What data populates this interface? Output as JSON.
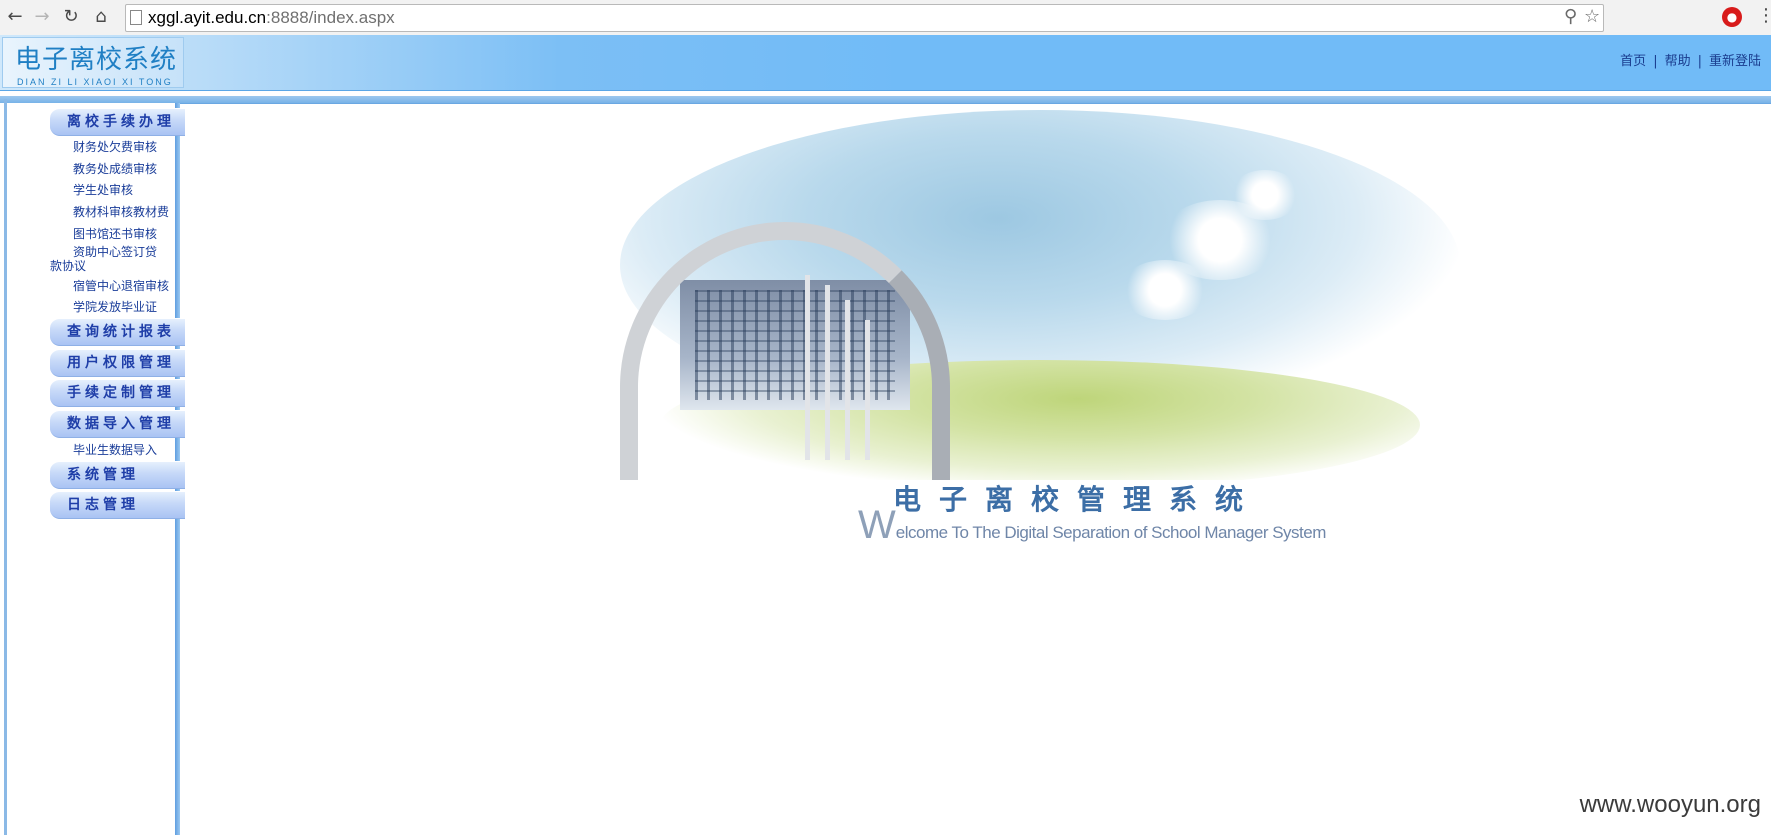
{
  "browser": {
    "url_host": "xggl.ayit.edu.cn",
    "url_rest": ":8888/index.aspx"
  },
  "header": {
    "logo_cn": "电子离校系统",
    "logo_en": "DIAN ZI LI XIAOI XI TONG",
    "links": [
      "首页",
      "帮助",
      "重新登陆"
    ],
    "separator": "|"
  },
  "sidebar": {
    "groups": [
      {
        "label": "离校手续办理",
        "items": [
          "财务处欠费审核",
          "教务处成绩审核",
          "学生处审核",
          "教材科审核教材费",
          "图书馆还书审核",
          "资助中心签订贷款协议",
          "宿管中心退宿审核",
          "学院发放毕业证"
        ]
      },
      {
        "label": "查询统计报表",
        "items": []
      },
      {
        "label": "用户权限管理",
        "items": []
      },
      {
        "label": "手续定制管理",
        "items": []
      },
      {
        "label": "数据导入管理",
        "items": [
          "毕业生数据导入"
        ]
      },
      {
        "label": "系统管理",
        "items": []
      },
      {
        "label": "日志管理",
        "items": []
      }
    ]
  },
  "banner": {
    "title": "电子离校管理系统",
    "subtitle_cap": "W",
    "subtitle_rest": "elcome To The Digital Separation of School Manager System"
  },
  "watermark": "www.wooyun.org",
  "colors": {
    "header_blue": "#71bbf7",
    "menu_text": "#1f3ea8",
    "title_blue": "#3c6ea6"
  }
}
